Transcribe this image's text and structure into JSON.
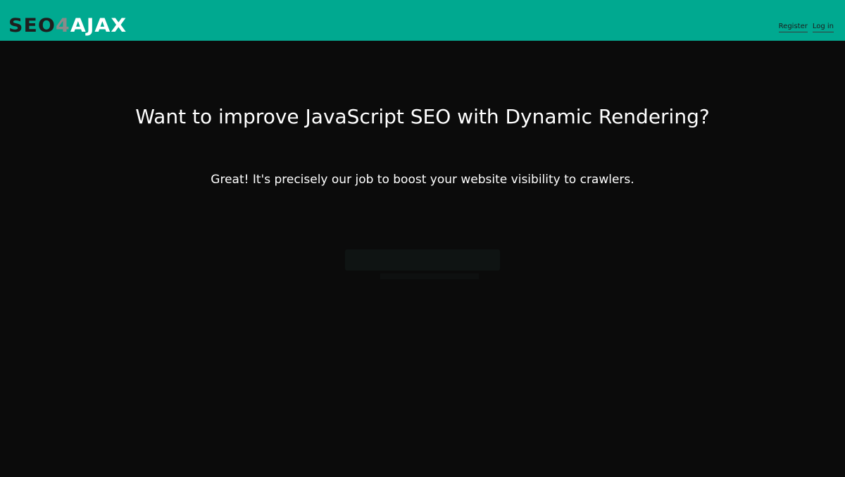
{
  "header": {
    "logo": {
      "part1": "SEO",
      "part2": "4",
      "part3": "AJAX"
    },
    "nav": {
      "register": "Register",
      "login": "Log in"
    }
  },
  "hero": {
    "title": "Want to improve JavaScript SEO with Dynamic Rendering?",
    "subtitle": "Great! It's precisely our job to boost your website visibility to crawlers."
  },
  "colors": {
    "header_bg": "#00a990",
    "page_bg": "#0b0b0b",
    "text": "#ffffff"
  }
}
